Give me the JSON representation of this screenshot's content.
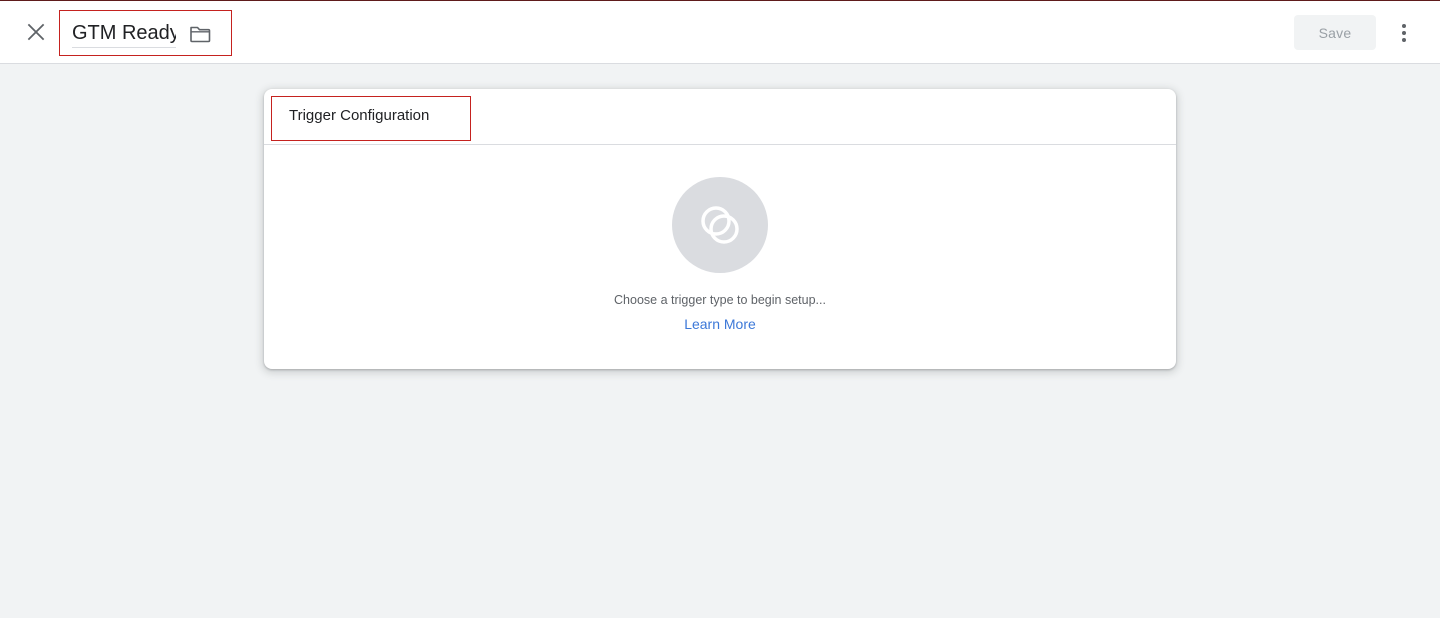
{
  "header": {
    "title_value": "GTM Ready",
    "save_label": "Save",
    "icons": {
      "close": "close-icon",
      "folder": "folder-icon",
      "more": "more-vert-icon"
    }
  },
  "trigger_card": {
    "title": "Trigger Configuration",
    "hint": "Choose a trigger type to begin setup...",
    "learn_more": "Learn More",
    "icon": "trigger-icon"
  },
  "colors": {
    "accent_link": "#3c78d8",
    "highlight_border": "#c5221f",
    "background": "#f1f3f4"
  }
}
